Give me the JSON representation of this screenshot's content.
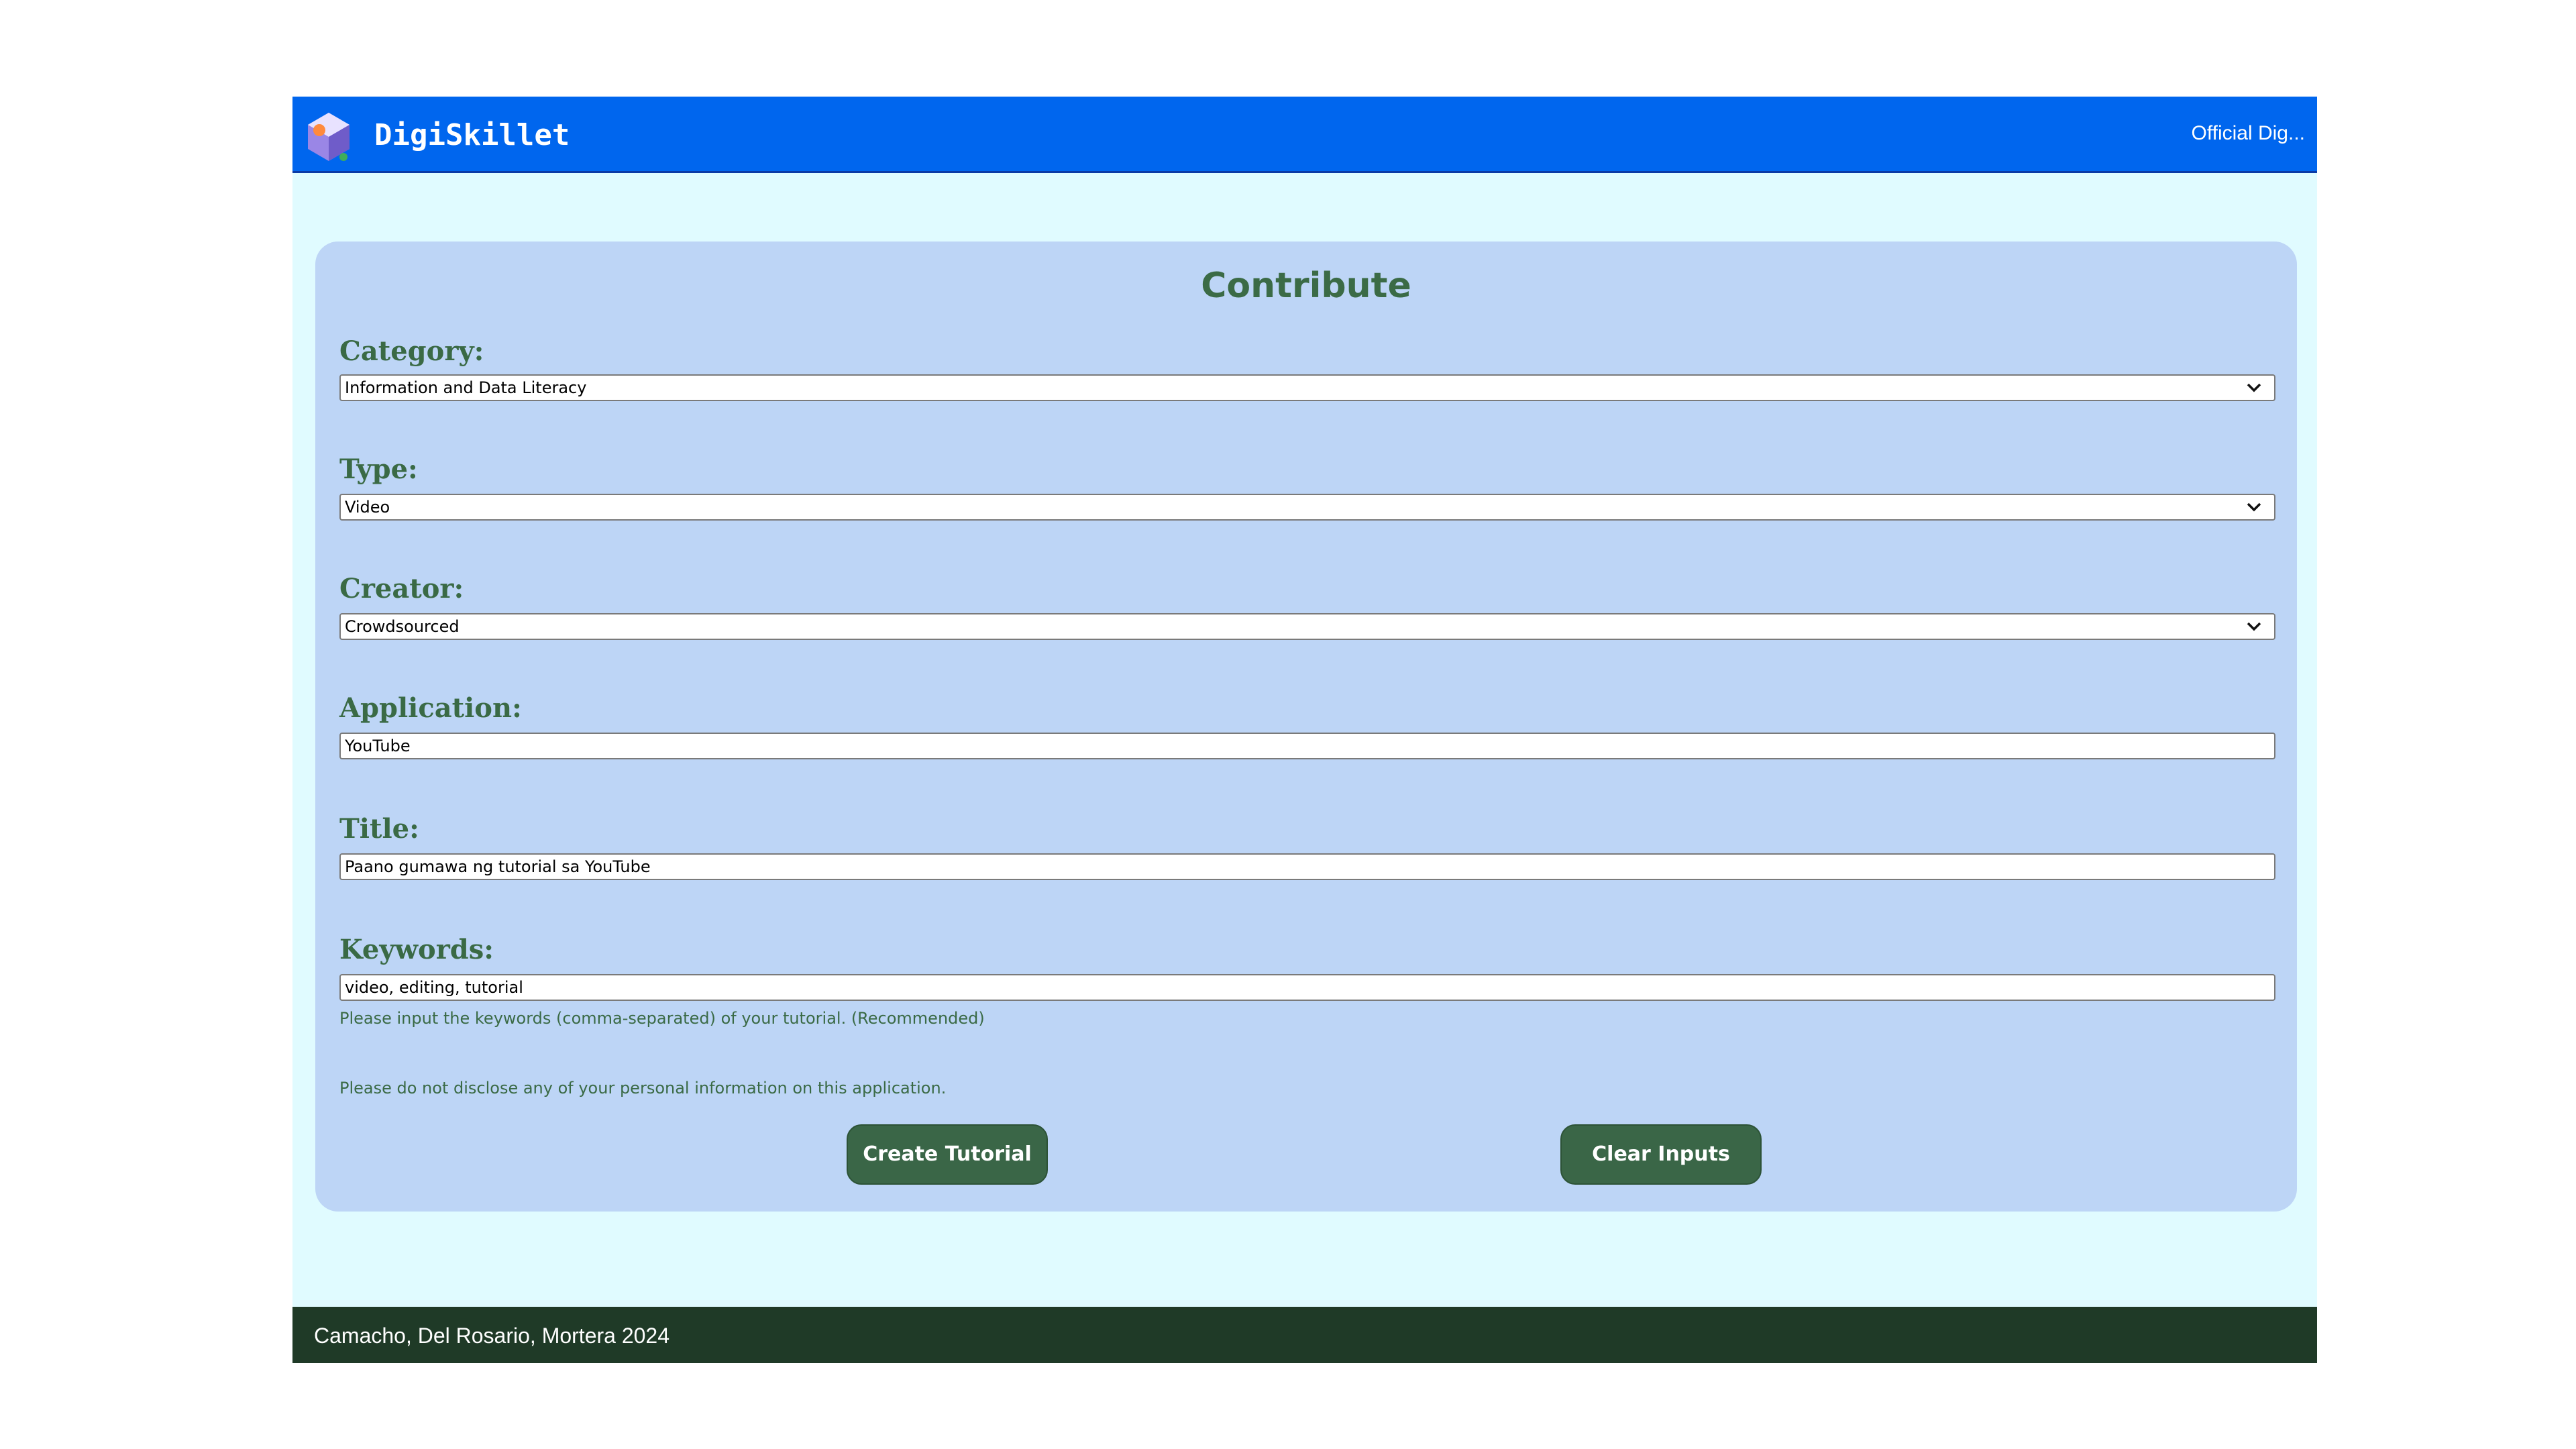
{
  "header": {
    "brand": "DigiSkillet",
    "link_label": "Official Dig..."
  },
  "form": {
    "title": "Contribute",
    "category": {
      "label": "Category:",
      "value": "Information and Data Literacy"
    },
    "type": {
      "label": "Type:",
      "value": "Video"
    },
    "creator": {
      "label": "Creator:",
      "value": "Crowdsourced"
    },
    "application": {
      "label": "Application:",
      "value": "YouTube"
    },
    "title_field": {
      "label": "Title:",
      "value": "Paano gumawa ng tutorial sa YouTube"
    },
    "keywords": {
      "label": "Keywords:",
      "value": "video, editing, tutorial",
      "hint": "Please input the keywords (comma-separated) of your tutorial. (Recommended)"
    },
    "privacy_note": "Please do not disclose any of your personal information on this application.",
    "create_button": "Create Tutorial",
    "clear_button": "Clear Inputs"
  },
  "footer": {
    "text": "Camacho, Del Rosario, Mortera 2024"
  },
  "colors": {
    "header_bg": "#0066ee",
    "page_bg": "#e0fbff",
    "card_bg": "#bdd5f6",
    "accent_green": "#3a6647",
    "footer_bg": "#1f3a27"
  },
  "icons": {
    "logo": "hexagon-logo-icon",
    "dropdown": "chevron-down-icon"
  }
}
